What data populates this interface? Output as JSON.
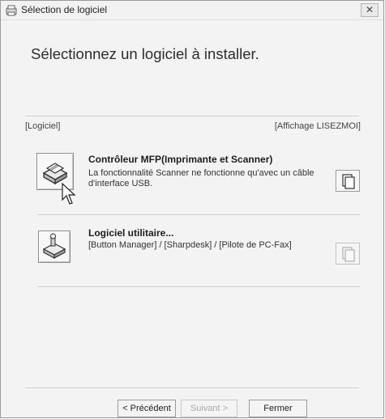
{
  "window": {
    "title": "Sélection de logiciel",
    "close_label": "✕"
  },
  "heading": "Sélectionnez un logiciel à installer.",
  "labels": {
    "left": "[Logiciel]",
    "right": "[Affichage LISEZMOI]"
  },
  "options": [
    {
      "title": "Contrôleur MFP(Imprimante et Scanner)",
      "description_line1": "La fonctionnalité Scanner ne fonctionne qu'avec un câble",
      "description_line2": "d'interface USB.",
      "icon": "printer-scanner-icon",
      "readme_icon": "document-icon",
      "readme_enabled": true
    },
    {
      "title": "Logiciel utilitaire...",
      "description_line1": "[Button Manager] / [Sharpdesk] / [Pilote de PC-Fax]",
      "icon": "utility-software-icon",
      "readme_icon": "document-icon",
      "readme_enabled": false
    }
  ],
  "footer": {
    "previous": "< Précédent",
    "next": "Suivant >",
    "close": "Fermer"
  }
}
